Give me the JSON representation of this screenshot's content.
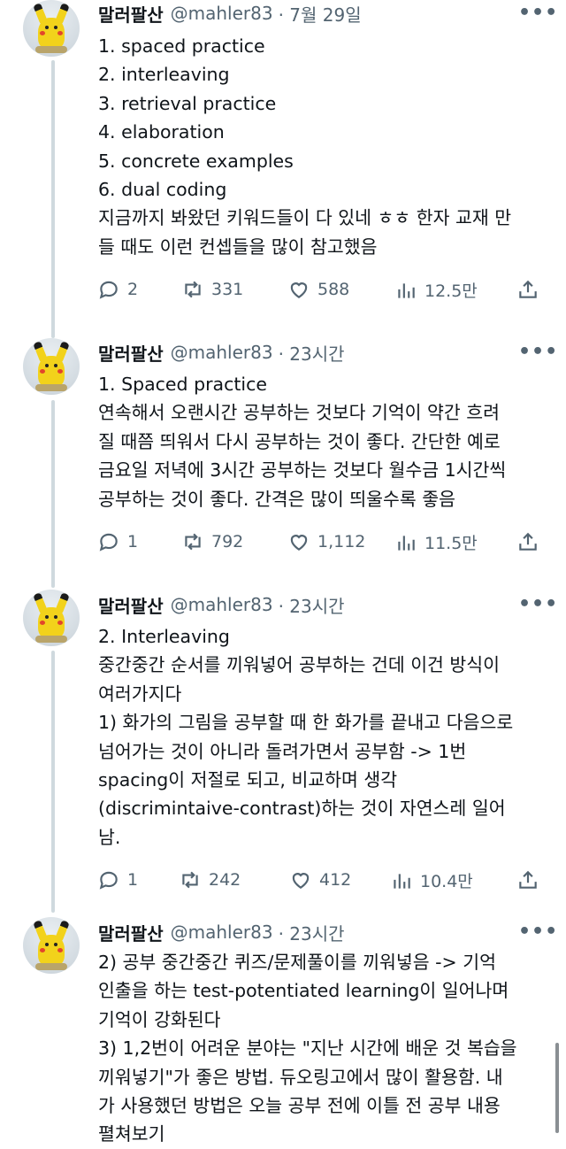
{
  "tweets": [
    {
      "name": "말러팔산",
      "handle": "@mahler83",
      "time": "· 7월 29일",
      "more": "•••",
      "lines": [
        "1. spaced practice",
        "2. interleaving",
        "3. retrieval practice",
        "4. elaboration",
        "5. concrete examples",
        "6. dual coding",
        "지금까지 봐왔던 키워드들이 다 있네 ㅎㅎ 한자 교재 만",
        "들 때도 이런 컨셉들을 많이 참고했음"
      ],
      "replies": "2",
      "retweets": "331",
      "likes": "588",
      "views": "12.5만"
    },
    {
      "name": "말러팔산",
      "handle": "@mahler83",
      "time": "· 23시간",
      "more": "•••",
      "lines": [
        "1. Spaced practice",
        "연속해서 오랜시간 공부하는 것보다 기억이 약간 흐려",
        "질 때쯤 띄워서 다시 공부하는 것이 좋다. 간단한 예로",
        "금요일 저녁에 3시간 공부하는 것보다 월수금 1시간씩",
        "공부하는 것이 좋다. 간격은 많이 띄울수록 좋음"
      ],
      "replies": "1",
      "retweets": "792",
      "likes": "1,112",
      "views": "11.5만"
    },
    {
      "name": "말러팔산",
      "handle": "@mahler83",
      "time": "· 23시간",
      "more": "•••",
      "lines": [
        "2. Interleaving",
        "중간중간 순서를 끼워넣어 공부하는 건데 이건 방식이",
        "여러가지다",
        "1) 화가의 그림을 공부할 때 한 화가를 끝내고 다음으로",
        "넘어가는 것이 아니라 돌려가면서 공부함 -> 1번",
        "spacing이 저절로 되고, 비교하며 생각",
        "(discrimintaive-contrast)하는 것이 자연스레 일어",
        "남."
      ],
      "replies": "1",
      "retweets": "242",
      "likes": "412",
      "views": "10.4만"
    },
    {
      "name": "말러팔산",
      "handle": "@mahler83",
      "time": "· 23시간",
      "more": "•••",
      "lines": [
        "2) 공부 중간중간 퀴즈/문제풀이를 끼워넣음 -> 기억",
        "인출을 하는 test-potentiated learning이 일어나며",
        "기억이 강화된다",
        "3) 1,2번이 어려운 분야는 \"지난 시간에 배운 것 복습을",
        "끼워넣기\"가 좋은 방법. 듀오링고에서 많이 활용함. 내",
        "가 사용했던 방법은 오늘 공부 전에 이틀 전 공부 내용",
        "펼쳐보기"
      ]
    }
  ],
  "icons": {
    "reply": "reply-icon",
    "retweet": "retweet-icon",
    "like": "heart-icon",
    "views": "views-icon",
    "share": "share-icon"
  }
}
